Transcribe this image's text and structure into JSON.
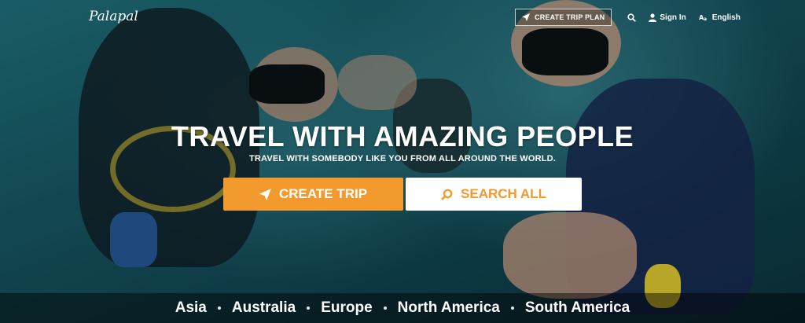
{
  "header": {
    "logo": "Palapal",
    "create_trip_plan": "CREATE TRIP PLAN",
    "sign_in": "Sign In",
    "language": "English"
  },
  "icons": {
    "plan": "paper-plane-icon",
    "search": "search-icon",
    "user": "user-icon",
    "language": "translate-icon"
  },
  "hero": {
    "headline": "TRAVEL WITH AMAZING PEOPLE",
    "subheadline": "TRAVEL WITH SOMEBODY LIKE YOU FROM ALL AROUND THE WORLD.",
    "create_trip": "CREATE TRIP",
    "search_all": "SEARCH ALL"
  },
  "regions": [
    "Asia",
    "Australia",
    "Europe",
    "North America",
    "South America"
  ],
  "colors": {
    "accent": "#f29a2e",
    "overlay_bar": "rgba(0,0,0,0.45)"
  }
}
